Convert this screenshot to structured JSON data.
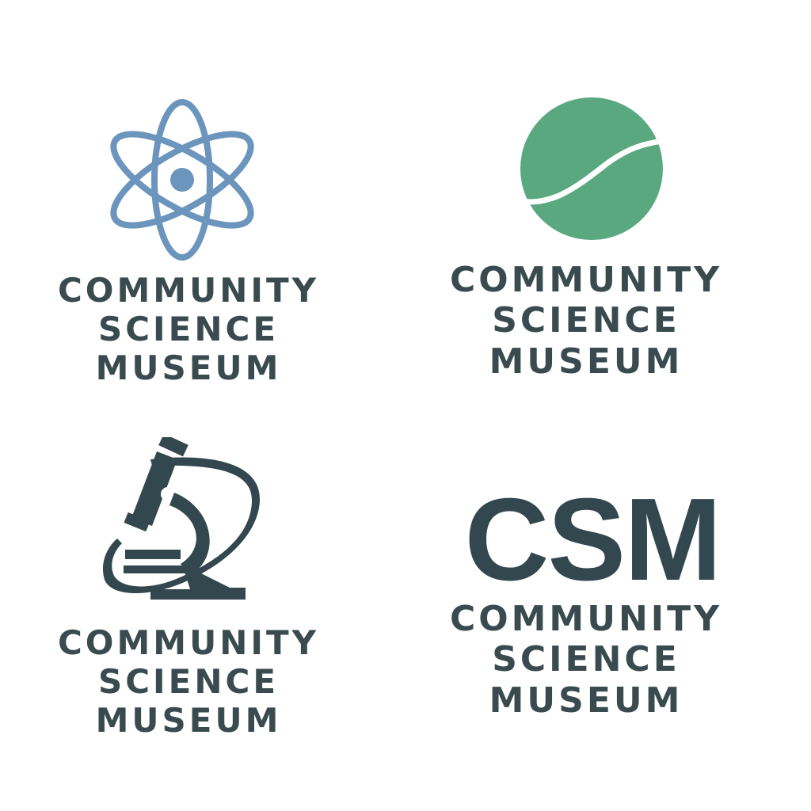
{
  "colors": {
    "text": "#3a4b4f",
    "atom_blue": "#6b95bd",
    "sphere_green": "#5aa880",
    "microscope": "#33484e"
  },
  "logos": [
    {
      "icon": "atom-icon",
      "lines": [
        "COMMUNITY",
        "SCIENCE",
        "MUSEUM"
      ]
    },
    {
      "icon": "green-sphere-icon",
      "lines": [
        "COMMUNITY",
        "SCIENCE",
        "MUSEUM"
      ]
    },
    {
      "icon": "microscope-icon",
      "lines": [
        "COMMUNITY",
        "SCIENCE",
        "MUSEUM"
      ]
    },
    {
      "monogram": "CSM",
      "lines": [
        "COMMUNITY",
        "SCIENCE",
        "MUSEUM"
      ]
    }
  ]
}
